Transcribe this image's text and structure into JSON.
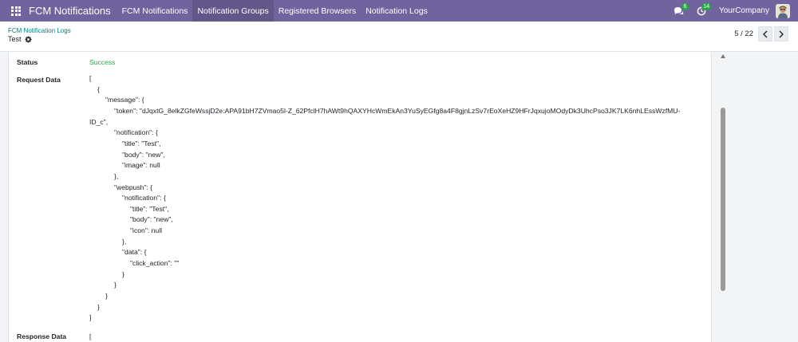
{
  "navbar": {
    "app_name": "FCM Notifications",
    "menu": [
      {
        "label": "FCM Notifications"
      },
      {
        "label": "Notification Groups"
      },
      {
        "label": "Registered Browsers"
      },
      {
        "label": "Notification Logs"
      }
    ],
    "messages_count": "6",
    "activities_count": "14",
    "company": "YourCompany"
  },
  "control_panel": {
    "breadcrumb": "FCM Notification Logs",
    "record_name": "Test",
    "pager": "5 / 22"
  },
  "form": {
    "status_label": "Status",
    "status_value": "Success",
    "request_label": "Request Data",
    "request_lines": [
      "[",
      "{",
      "\"message\": {",
      "\"token\": \"dJqxtG_8elkZGfeWssjD2e:APA91bH7ZVmao5l-Z_62PfclH7hAWt9hQAXYHcWmEkAn3YuSyEGfg8a4F8gjnLzSv7rEoXeHZ9HFrJqxujoMOdyDk3UhcPso3JK7LK6nhLEssWzfMU-",
      "ID_c\",",
      "\"notification\": {",
      "\"title\": \"Test\",",
      "\"body\": \"new\",",
      "\"image\": null",
      "},",
      "\"webpush\": {",
      "\"notification\": {",
      "\"title\": \"Test\",",
      "\"body\": \"new\",",
      "\"icon\": null",
      "},",
      "\"data\": {",
      "\"click_action\": \"\"",
      "}",
      "}",
      "}",
      "}",
      "]"
    ],
    "response_label": "Response Data",
    "response_first_line": "["
  },
  "colors": {
    "navbar": "#71639e",
    "success": "#28a745",
    "link": "#017e84"
  },
  "icons": [
    "apps-grid-icon",
    "chat-icon",
    "clock-icon",
    "gear-icon",
    "chevron-left-icon",
    "chevron-right-icon",
    "scroll-up-icon"
  ]
}
